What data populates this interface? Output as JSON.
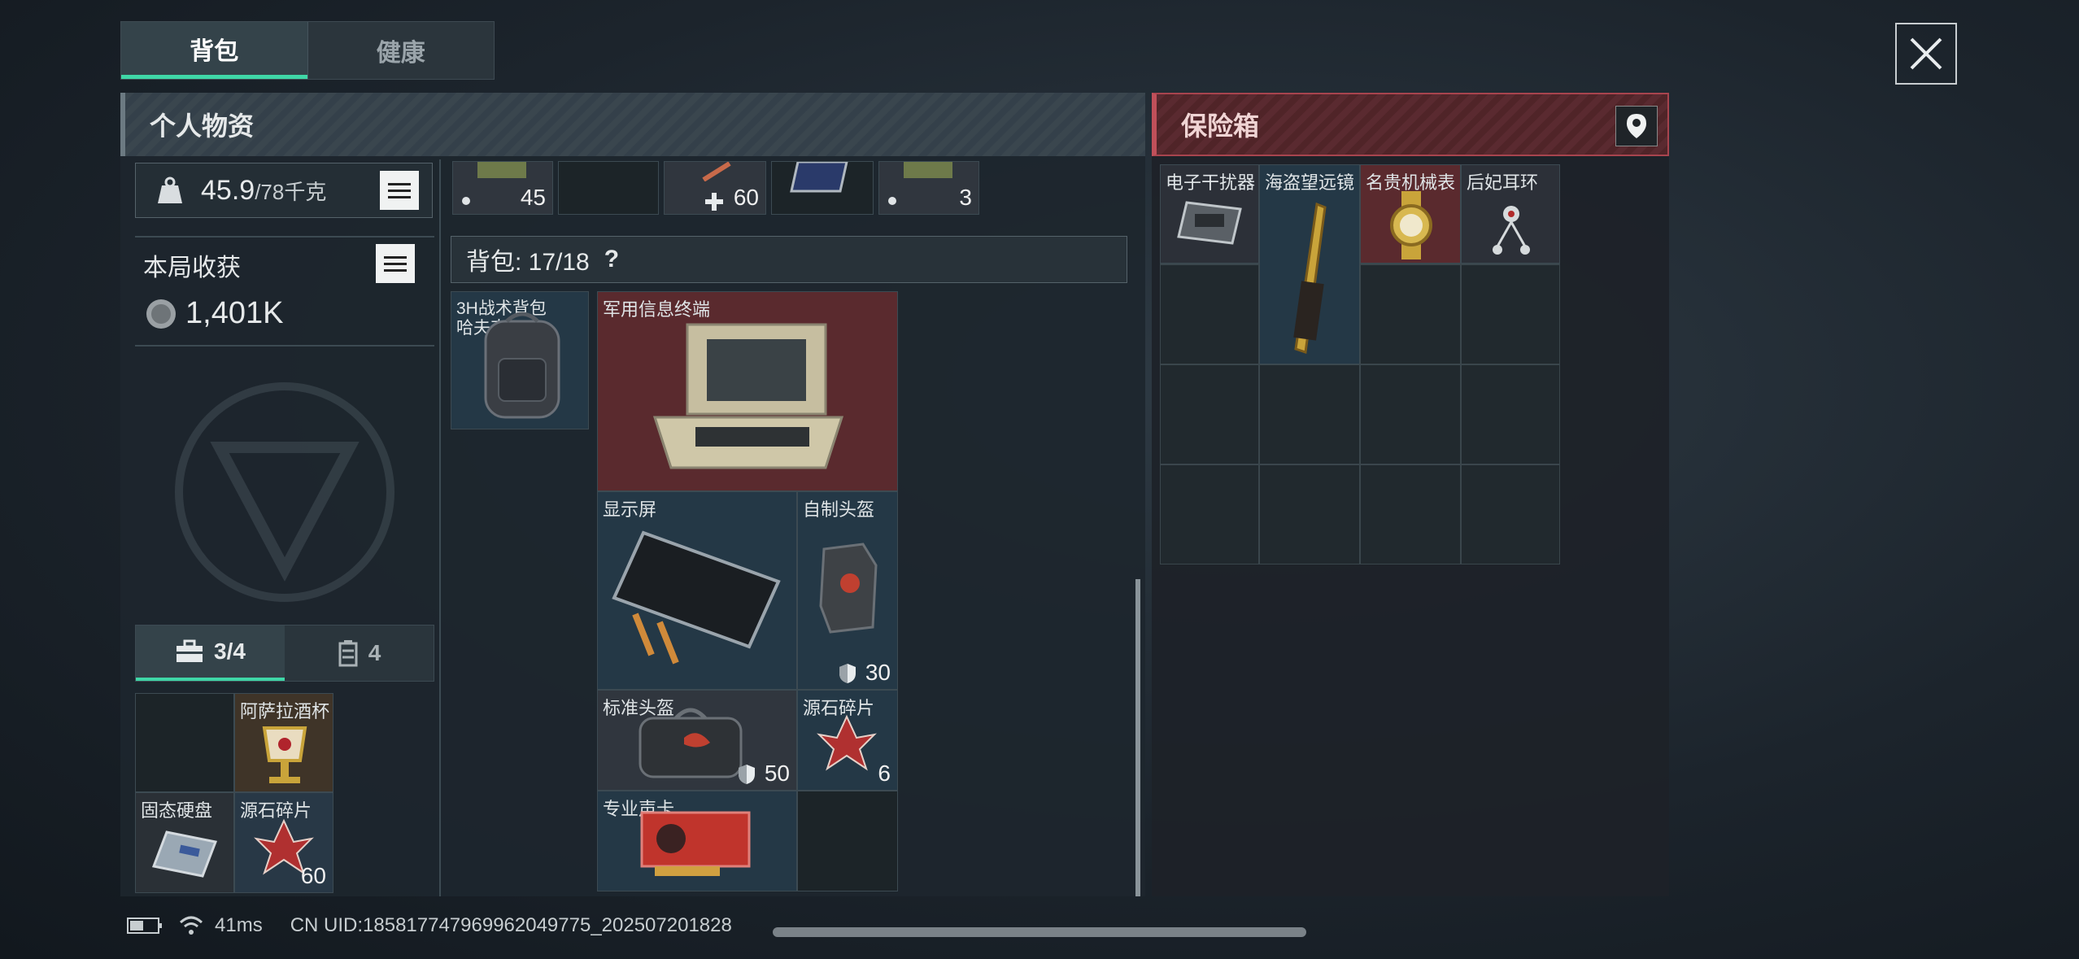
{
  "tabs": [
    {
      "label": "背包"
    },
    {
      "label": "健康"
    }
  ],
  "left_panel": {
    "title": "个人物资"
  },
  "weight": {
    "current": "45.9",
    "max": "/78千克"
  },
  "harvest": {
    "label": "本局收获",
    "value": "1,401K"
  },
  "bottom_tabs": [
    {
      "label": "3/4"
    },
    {
      "label": "4"
    }
  ],
  "pocket": [
    {
      "label": "",
      "count": ""
    },
    {
      "label": "阿萨拉酒杯",
      "count": ""
    },
    {
      "label": "固态硬盘",
      "count": ""
    },
    {
      "label": "源石碎片",
      "count": "60"
    }
  ],
  "top_strip": [
    {
      "count": "45"
    },
    {
      "count": ""
    },
    {
      "count": "60"
    },
    {
      "count": ""
    },
    {
      "count": "3"
    }
  ],
  "backpack": {
    "label": "背包: 17/18",
    "help": "?",
    "bag_item": {
      "label": "3H战术背包",
      "sub": "哈夫克"
    },
    "items": [
      {
        "label": "军用信息终端",
        "count": ""
      },
      {
        "label": "显示屏",
        "count": ""
      },
      {
        "label": "自制头盔",
        "count": "30"
      },
      {
        "label": "标准头盔",
        "count": "50"
      },
      {
        "label": "源石碎片",
        "count": "6"
      },
      {
        "label": "专业声卡",
        "count": ""
      }
    ]
  },
  "safe_box": {
    "title": "保险箱",
    "items": [
      {
        "label": "电子干扰器"
      },
      {
        "label": "海盗望远镜"
      },
      {
        "label": "名贵机械表"
      },
      {
        "label": "后妃耳环"
      }
    ]
  },
  "status": {
    "ping": "41ms",
    "uid": "CN UID:185817747969962049775_202507201828"
  },
  "colors": {
    "accent": "#3fd7a7",
    "safe_red": "#a8444e"
  }
}
